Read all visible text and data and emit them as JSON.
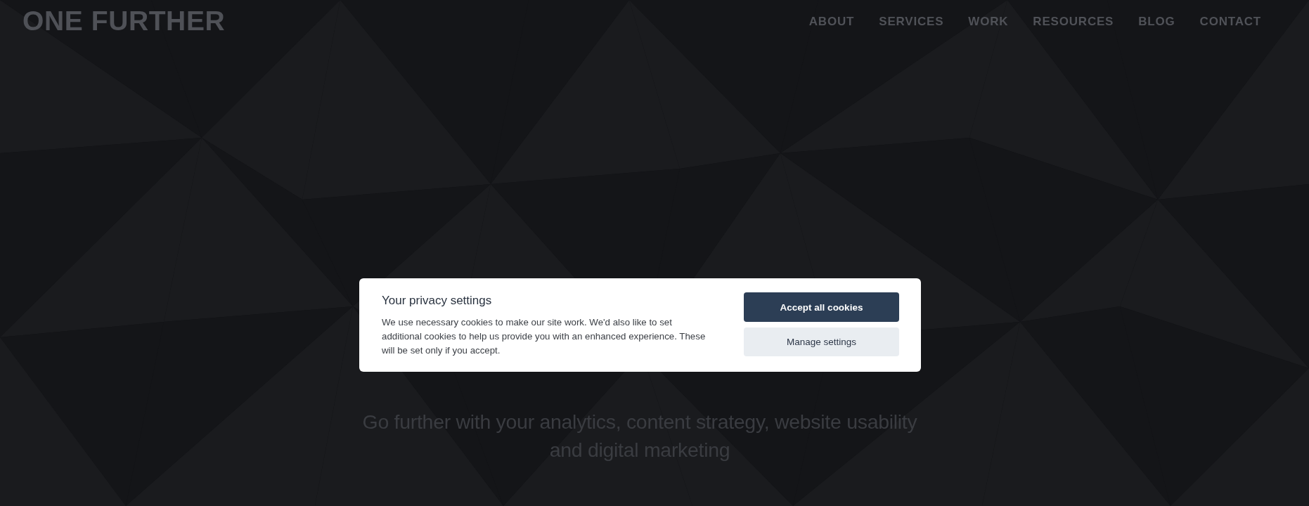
{
  "header": {
    "logo": "ONE FURTHER",
    "nav": [
      "ABOUT",
      "SERVICES",
      "WORK",
      "RESOURCES",
      "BLOG",
      "CONTACT"
    ]
  },
  "hero": {
    "subtitle": "Go further with your analytics, content strategy, website usability and digital marketing"
  },
  "cookie_dialog": {
    "title": "Your privacy settings",
    "text": "We use necessary cookies to make our site work. We'd also like to set additional cookies to help us provide you with an enhanced experience. These will be set only if you accept.",
    "buttons": [
      {
        "label": "Accept all cookies",
        "kind": "primary"
      },
      {
        "label": "Manage settings",
        "kind": "secondary"
      }
    ]
  }
}
